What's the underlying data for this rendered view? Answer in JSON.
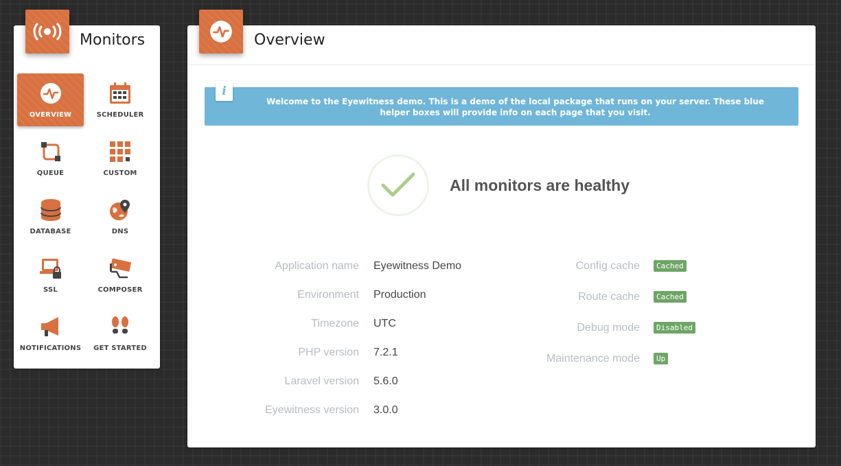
{
  "sidebar": {
    "title": "Monitors",
    "items": [
      {
        "label": "OVERVIEW",
        "icon": "activity-icon",
        "active": true
      },
      {
        "label": "SCHEDULER",
        "icon": "calendar-icon"
      },
      {
        "label": "QUEUE",
        "icon": "queue-icon"
      },
      {
        "label": "CUSTOM",
        "icon": "grid-icon"
      },
      {
        "label": "DATABASE",
        "icon": "database-icon"
      },
      {
        "label": "DNS",
        "icon": "globe-pin-icon"
      },
      {
        "label": "SSL",
        "icon": "laptop-lock-icon"
      },
      {
        "label": "COMPOSER",
        "icon": "camera-icon"
      },
      {
        "label": "NOTIFICATIONS",
        "icon": "megaphone-icon"
      },
      {
        "label": "GET STARTED",
        "icon": "footprints-icon"
      }
    ]
  },
  "main": {
    "title": "Overview",
    "info": "Welcome to the Eyewitness demo. This is a demo of the local package that runs on your server. These blue helper boxes will provide info on each page that you visit.",
    "health": "All monitors are healthy",
    "app_info": [
      {
        "label": "Application name",
        "value": "Eyewitness Demo"
      },
      {
        "label": "Environment",
        "value": "Production"
      },
      {
        "label": "Timezone",
        "value": "UTC"
      },
      {
        "label": "PHP version",
        "value": "7.2.1"
      },
      {
        "label": "Laravel version",
        "value": "5.6.0"
      },
      {
        "label": "Eyewitness version",
        "value": "3.0.0"
      }
    ],
    "status_info": [
      {
        "label": "Config cache",
        "value": "Cached"
      },
      {
        "label": "Route cache",
        "value": "Cached"
      },
      {
        "label": "Debug mode",
        "value": "Disabled"
      },
      {
        "label": "Maintenance mode",
        "value": "Up"
      }
    ]
  },
  "colors": {
    "accent": "#d8703f",
    "info": "#6fb6d8",
    "success": "#6ea566"
  }
}
